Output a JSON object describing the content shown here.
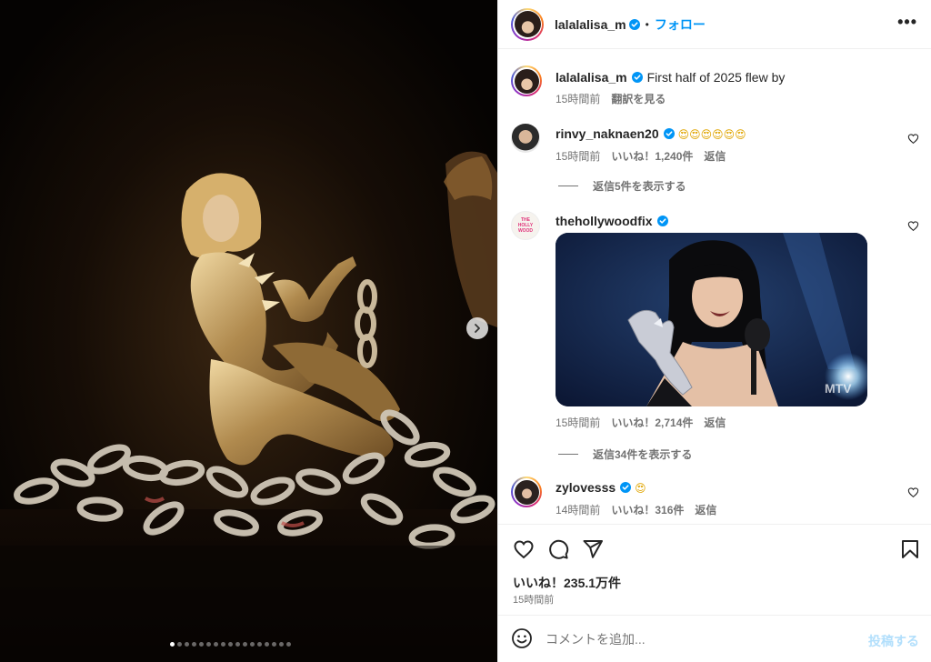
{
  "post": {
    "author": "lalalalisa_m",
    "follow_label": "フォロー",
    "separator": "•",
    "more_label": "•••"
  },
  "caption": {
    "username": "lalalalisa_m",
    "text": "First half of 2025 flew by",
    "time": "15時間前",
    "translate": "翻訳を見る"
  },
  "comments": [
    {
      "username": "rinvy_naknaen20",
      "text": "😍😍😍😍😍😍",
      "time": "15時間前",
      "likes": "いいね！1,240件",
      "reply": "返信",
      "view_replies": "返信5件を表示する"
    },
    {
      "username": "thehollywoodfix",
      "avatar_text": "THE HOLLY WOOD",
      "time": "15時間前",
      "likes": "いいね！2,714件",
      "reply": "返信",
      "view_replies": "返信34件を表示する"
    },
    {
      "username": "zylovesss",
      "text": "😍",
      "time": "14時間前",
      "likes": "いいね！316件",
      "reply": "返信"
    }
  ],
  "footer": {
    "likes": "いいね！235.1万件",
    "time": "15時間前"
  },
  "composer": {
    "placeholder": "コメントを追加...",
    "post_label": "投稿する"
  },
  "carousel": {
    "count": 17,
    "active_index": 0
  },
  "colors": {
    "link": "#0095f6",
    "verified": "#0095f6",
    "muted": "#737373",
    "post_disabled": "#b2dffc"
  },
  "icons": [
    "chevron-right-icon",
    "verified-icon",
    "more-icon",
    "heart-icon",
    "comment-icon",
    "share-icon",
    "bookmark-icon",
    "emoji-icon"
  ]
}
